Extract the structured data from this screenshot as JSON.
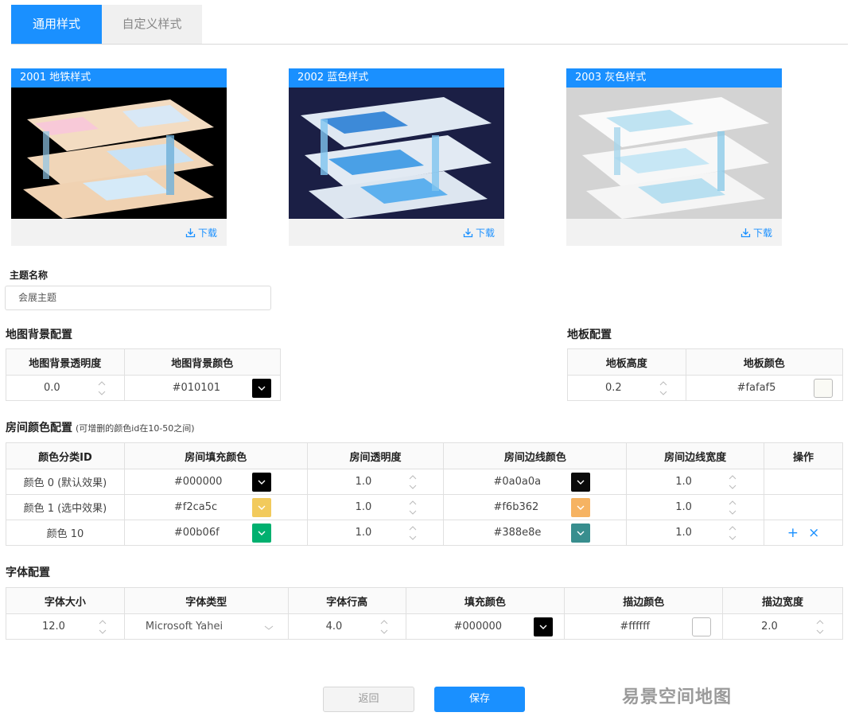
{
  "tabs": {
    "general": "通用样式",
    "custom": "自定义样式"
  },
  "cards": [
    {
      "title": "2001 地铁样式",
      "download": "下载",
      "bg": "#000000"
    },
    {
      "title": "2002 蓝色样式",
      "download": "下载",
      "bg": "#1b1f45"
    },
    {
      "title": "2003 灰色样式",
      "download": "下载",
      "bg": "#d3d3d3"
    }
  ],
  "theme": {
    "label": "主题名称",
    "value": "会展主题"
  },
  "map_bg": {
    "title": "地图背景配置",
    "col_opacity": "地图背景透明度",
    "col_color": "地图背景颜色",
    "opacity": "0.0",
    "color": "#010101"
  },
  "floor": {
    "title": "地板配置",
    "col_height": "地板高度",
    "col_color": "地板颜色",
    "height": "0.2",
    "color": "#fafaf5"
  },
  "room": {
    "title": "房间颜色配置",
    "hint": "(可增删的颜色id在10-50之间)",
    "headers": [
      "颜色分类ID",
      "房间填充颜色",
      "房间透明度",
      "房间边线颜色",
      "房间边线宽度",
      "操作"
    ],
    "rows": [
      {
        "id": "颜色 0 (默认效果)",
        "fill": "#000000",
        "fill_swatch": "#000000",
        "opacity": "1.0",
        "border": "#0a0a0a",
        "border_swatch": "#0a0a0a",
        "width": "1.0"
      },
      {
        "id": "颜色 1 (选中效果)",
        "fill": "#f2ca5c",
        "fill_swatch": "#f2ca5c",
        "opacity": "1.0",
        "border": "#f6b362",
        "border_swatch": "#f6b362",
        "width": "1.0"
      },
      {
        "id": "颜色 10",
        "fill": "#00b06f",
        "fill_swatch": "#00b06f",
        "opacity": "1.0",
        "border": "#388e8e",
        "border_swatch": "#388e8e",
        "width": "1.0"
      }
    ],
    "add_symbol": "+",
    "remove_symbol": "×"
  },
  "font": {
    "title": "字体配置",
    "headers": [
      "字体大小",
      "字体类型",
      "字体行高",
      "填充颜色",
      "描边颜色",
      "描边宽度"
    ],
    "size": "12.0",
    "family": "Microsoft Yahei",
    "line_height": "4.0",
    "fill": "#000000",
    "fill_swatch": "#000000",
    "stroke": "#ffffff",
    "stroke_swatch": "#ffffff",
    "stroke_width": "2.0"
  },
  "buttons": {
    "back": "返回",
    "save": "保存"
  },
  "watermark": "易景空间地图"
}
